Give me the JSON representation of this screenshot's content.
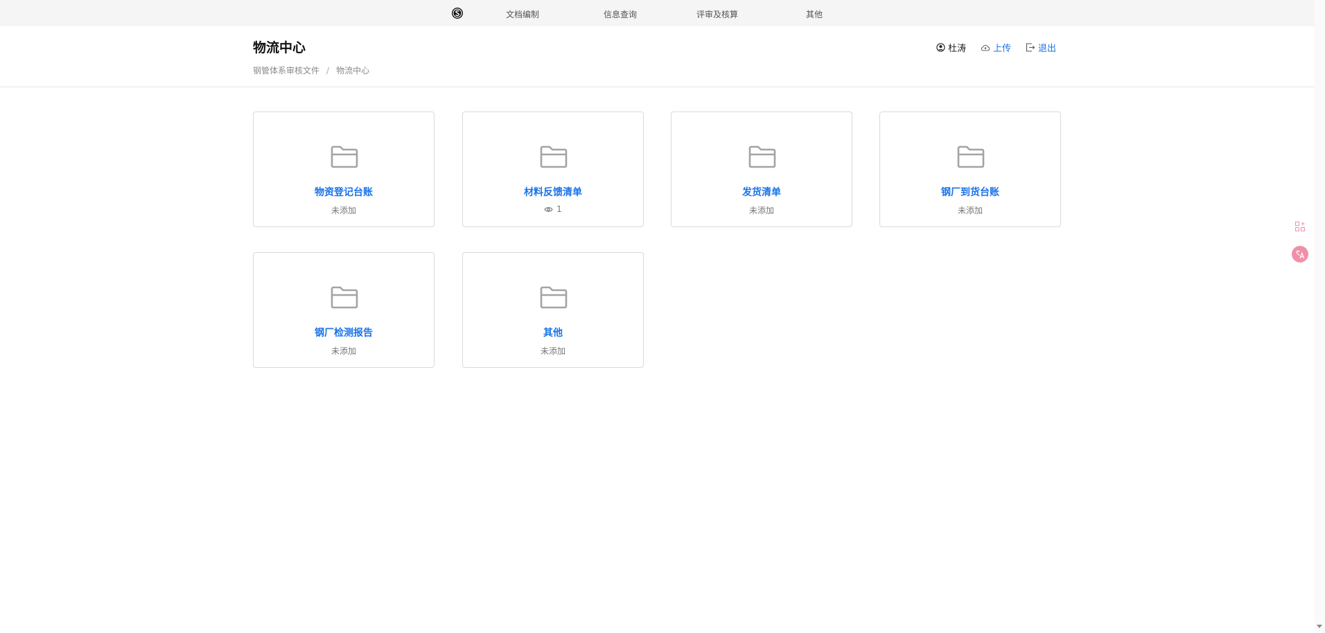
{
  "nav": {
    "items": [
      {
        "label": "文档编制"
      },
      {
        "label": "信息查询"
      },
      {
        "label": "评审及核算"
      },
      {
        "label": "其他"
      }
    ]
  },
  "header": {
    "title": "物流中心",
    "breadcrumb": [
      "钢管体系审核文件",
      "/",
      "物流中心"
    ],
    "user_name": "杜涛",
    "upload_label": "上传",
    "logout_label": "退出"
  },
  "cards": [
    {
      "title": "物资登记台账",
      "status": "未添加",
      "icon": "folder-icon"
    },
    {
      "title": "材料反馈清单",
      "status": "1",
      "status_icon": "eye-icon",
      "icon": "folder-icon"
    },
    {
      "title": "发货清单",
      "status": "未添加",
      "icon": "folder-icon"
    },
    {
      "title": "钢厂到货台账",
      "status": "未添加",
      "icon": "folder-icon"
    },
    {
      "title": "钢厂检测报告",
      "status": "未添加",
      "icon": "folder-icon"
    },
    {
      "title": "其他",
      "status": "未添加",
      "icon": "folder-icon"
    }
  ],
  "side_tools": [
    {
      "icon": "apps-add-icon"
    },
    {
      "icon": "translate-icon"
    }
  ],
  "colors": {
    "accent": "#1a73e8",
    "nav_bg": "#f5f5f5",
    "card_border": "#d9d9d9",
    "translate_badge": "#f08fa8"
  }
}
